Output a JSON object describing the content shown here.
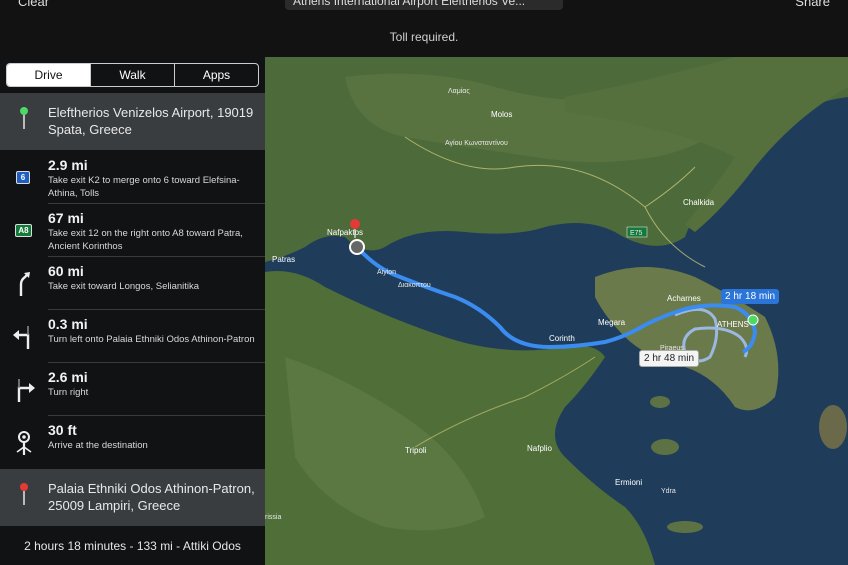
{
  "topbar": {
    "clear_label": "Clear",
    "destination_field": "Athens International Airport Eleftherios Ve...",
    "share_label": "Share",
    "toll_notice": "Toll required."
  },
  "tabs": [
    {
      "label": "Drive",
      "active": true
    },
    {
      "label": "Walk",
      "active": false
    },
    {
      "label": "Apps",
      "active": false
    }
  ],
  "start": {
    "address": "Eleftherios Venizelos Airport, 19019 Spata, Greece",
    "pin_color": "#4cd964"
  },
  "steps": [
    {
      "distance": "2.9 mi",
      "instruction": "Take exit K2 to merge onto 6 toward Elefsina-Athina, Tolls",
      "icon": "highway-6-shield-icon",
      "badge": "6"
    },
    {
      "distance": "67 mi",
      "instruction": "Take exit 12 on the right onto A8 toward Patra, Ancient Korinthos",
      "icon": "a8-highway-shield-icon",
      "badge": "A8"
    },
    {
      "distance": "60 mi",
      "instruction": "Take exit toward Longos, Selianitika",
      "icon": "bear-right-arrow-icon"
    },
    {
      "distance": "0.3 mi",
      "instruction": "Turn left onto Palaia Ethniki Odos Athinon-Patron",
      "icon": "turn-left-arrow-icon"
    },
    {
      "distance": "2.6 mi",
      "instruction": "Turn right",
      "icon": "turn-right-arrow-icon"
    },
    {
      "distance": "30 ft",
      "instruction": "Arrive at the destination",
      "icon": "arrive-destination-icon"
    }
  ],
  "end": {
    "address": "Palaia Ethniki Odos Athinon-Patron, 25009 Lampiri, Greece",
    "pin_color": "#e53935"
  },
  "summary": "2 hours 18 minutes - 133 mi - Attiki Odos",
  "map": {
    "labels": {
      "lamia": "Λαμίας",
      "molos": "Molos",
      "agiou": "Αγίου Κωνσταντίνου",
      "chalkida": "Chalkida",
      "e75": "E75",
      "nafpaktos": "Nafpaktos",
      "patras": "Patras",
      "aigion": "Aiyion",
      "diakoptou": "Διακοπτου",
      "acharnes": "Acharnes",
      "athens": "ATHENS",
      "megara": "Megara",
      "corinth": "Corinth",
      "piraeus": "Piraeus",
      "nafplio": "Nafplio",
      "tripoli": "Tripoli",
      "ermioni": "Ermioni",
      "ydra": "Ydra",
      "krissia": "rissia"
    },
    "route_primary_time": "2 hr 18 min",
    "route_alt_time": "2 hr 48 min",
    "route_color": "#3b8cf0",
    "alt_route_color": "#9ab8e0"
  }
}
